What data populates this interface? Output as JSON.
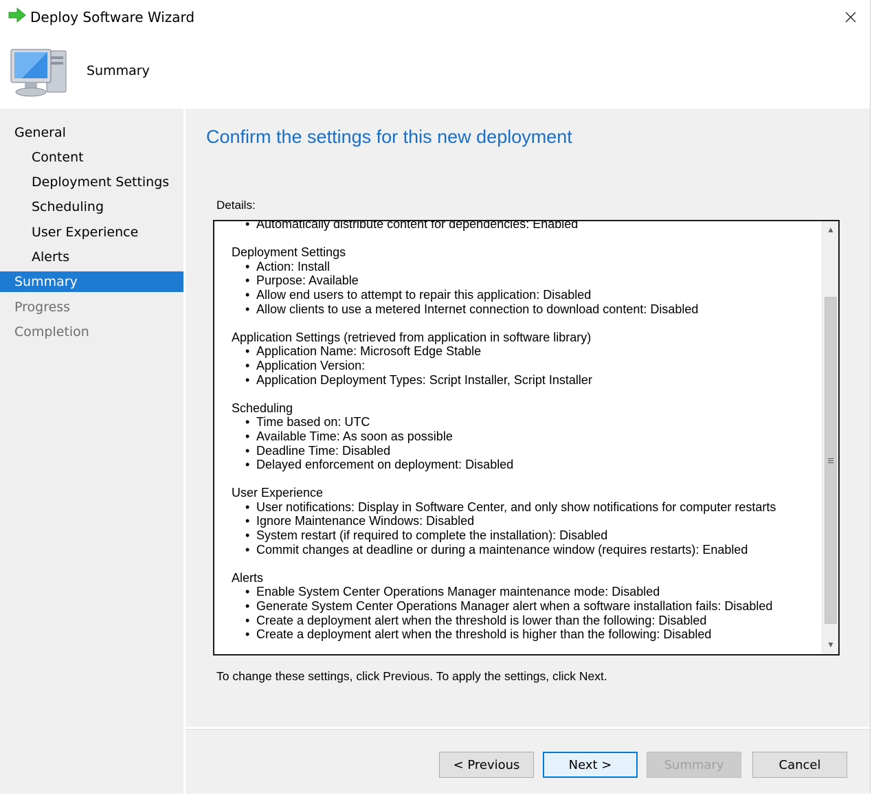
{
  "window": {
    "title": "Deploy Software Wizard"
  },
  "banner": {
    "title": "Summary"
  },
  "nav": {
    "items": [
      {
        "label": "General",
        "level": "top",
        "state": "normal"
      },
      {
        "label": "Content",
        "level": "sub",
        "state": "normal"
      },
      {
        "label": "Deployment Settings",
        "level": "sub",
        "state": "normal"
      },
      {
        "label": "Scheduling",
        "level": "sub",
        "state": "normal"
      },
      {
        "label": "User Experience",
        "level": "sub",
        "state": "normal"
      },
      {
        "label": "Alerts",
        "level": "sub",
        "state": "normal"
      },
      {
        "label": "Summary",
        "level": "top",
        "state": "active"
      },
      {
        "label": "Progress",
        "level": "top",
        "state": "disabled"
      },
      {
        "label": "Completion",
        "level": "top",
        "state": "disabled"
      }
    ]
  },
  "main": {
    "heading": "Confirm the settings for this new deployment",
    "details_label": "Details:",
    "footer_note": "To change these settings, click Previous. To apply the settings, click Next."
  },
  "details": {
    "partial_line": "Automatically distribute content for dependencies: Enabled",
    "sections": [
      {
        "title": "Deployment Settings",
        "items": [
          "Action: Install",
          "Purpose: Available",
          "Allow end users to attempt to repair this application: Disabled",
          "Allow clients to use a metered Internet connection to download content: Disabled"
        ]
      },
      {
        "title": "Application Settings (retrieved from application in software library)",
        "items": [
          "Application Name: Microsoft Edge Stable",
          "Application Version:",
          "Application Deployment Types: Script Installer, Script Installer"
        ]
      },
      {
        "title": "Scheduling",
        "items": [
          "Time based on: UTC",
          "Available Time: As soon as possible",
          "Deadline Time: Disabled",
          "Delayed enforcement on deployment: Disabled"
        ]
      },
      {
        "title": "User Experience",
        "items": [
          "User notifications: Display in Software Center, and only show notifications for computer restarts",
          "Ignore Maintenance Windows: Disabled",
          "System restart  (if required to complete the installation): Disabled",
          "Commit changes at deadline or during a maintenance window (requires restarts): Enabled"
        ]
      },
      {
        "title": "Alerts",
        "items": [
          "Enable System Center Operations Manager maintenance mode: Disabled",
          "Generate System Center Operations Manager alert when a software installation fails: Disabled",
          "Create a deployment alert when the threshold is lower than the following: Disabled",
          "Create a deployment alert when the threshold is higher than the following: Disabled"
        ]
      }
    ]
  },
  "buttons": {
    "previous": "< Previous",
    "next": "Next >",
    "summary": "Summary",
    "cancel": "Cancel"
  },
  "icons": {
    "title": "green-arrow-icon",
    "banner": "computer-icon",
    "close": "close-icon"
  },
  "colors": {
    "accent": "#1e7bd4",
    "heading": "#1a6fc4"
  }
}
